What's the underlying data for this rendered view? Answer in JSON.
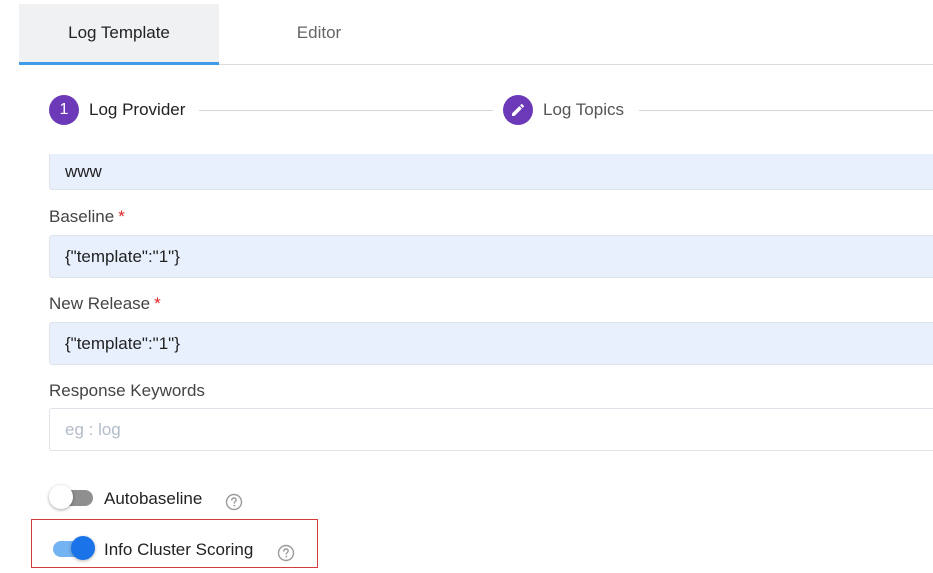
{
  "tabs": [
    {
      "label": "Log Template",
      "active": true
    },
    {
      "label": "Editor",
      "active": false
    }
  ],
  "stepper": {
    "step1": {
      "number": "1",
      "label": "Log Provider"
    },
    "step2": {
      "icon": "pencil-icon",
      "label": "Log Topics"
    }
  },
  "form": {
    "url_value": "www",
    "baseline": {
      "label": "Baseline",
      "required_mark": "*",
      "value": "{\"template\":\"1\"}"
    },
    "new_release": {
      "label": "New Release",
      "required_mark": "*",
      "value": "{\"template\":\"1\"}"
    },
    "response_keywords": {
      "label": "Response Keywords",
      "value": "",
      "placeholder": "eg : log"
    },
    "autobaseline": {
      "label": "Autobaseline",
      "enabled": false,
      "help_icon": "question-circle-icon"
    },
    "info_cluster_scoring": {
      "label": "Info Cluster Scoring",
      "enabled": true,
      "help_icon": "question-circle-icon"
    }
  },
  "colors": {
    "accent_purple": "#6c3ab8",
    "tab_indicator": "#3f9be8",
    "toggle_on": "#1a73e8",
    "required": "#e02020",
    "highlight_border": "#d23c3c",
    "field_fill": "#e8f0fe"
  }
}
